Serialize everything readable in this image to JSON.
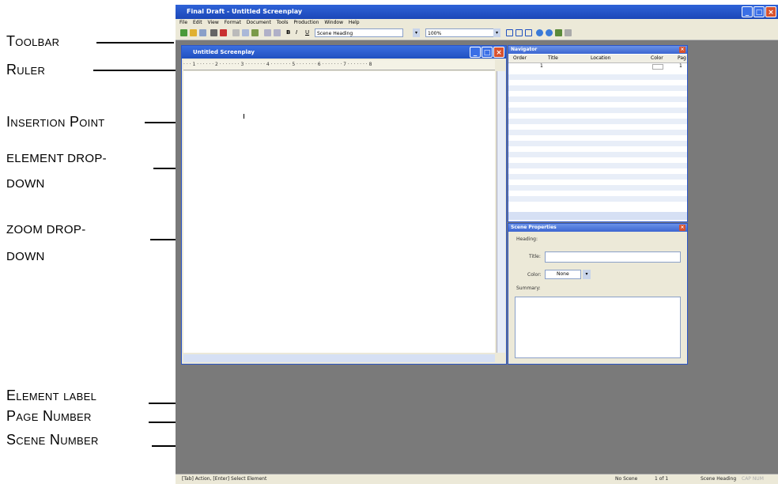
{
  "annotations": {
    "toolbar": "Toolbar",
    "ruler": "Ruler",
    "insertion_point": "Insertion Point",
    "element_dropdown_1": "element drop-",
    "element_dropdown_2": "down",
    "zoom_dropdown_1": "zoom drop-",
    "zoom_dropdown_2": "down",
    "element_label": "Element label",
    "page_number": "Page Number",
    "scene_number": "Scene Number"
  },
  "app": {
    "title": "Final Draft - Untitled Screenplay",
    "menu": [
      "File",
      "Edit",
      "View",
      "Format",
      "Document",
      "Tools",
      "Production",
      "Window",
      "Help"
    ],
    "element_dropdown_value": "Scene Heading",
    "zoom_value": "100%"
  },
  "doc_window": {
    "title": "Untitled Screenplay",
    "ruler_text": "· · · 1 · · · · · · 2 · · · · · · · 3 · · · · · · · 4 · · · · · · · 5 · · · · · · · 6 · · · · · · · 7 · · · · · · · 8"
  },
  "navigator": {
    "title": "Navigator",
    "columns": [
      "Order",
      "Title",
      "Location",
      "Color",
      "Pag"
    ],
    "rows": [
      {
        "order": "1",
        "page": "1"
      }
    ]
  },
  "scene_properties": {
    "title": "Scene Properties",
    "heading_label": "Heading:",
    "title_label": "Title:",
    "color_label": "Color:",
    "color_value": "None",
    "summary_label": "Summary:"
  },
  "status": {
    "hint": "[Tab] Action, [Enter] Select Element",
    "scene": "No Scene",
    "page": "1 of 1",
    "element": "Scene Heading",
    "caps": "CAP NUM"
  },
  "colors": {
    "xp_blue": "#2050c0",
    "workspace_gray": "#7a7a7a",
    "close_red": "#d8522e"
  }
}
